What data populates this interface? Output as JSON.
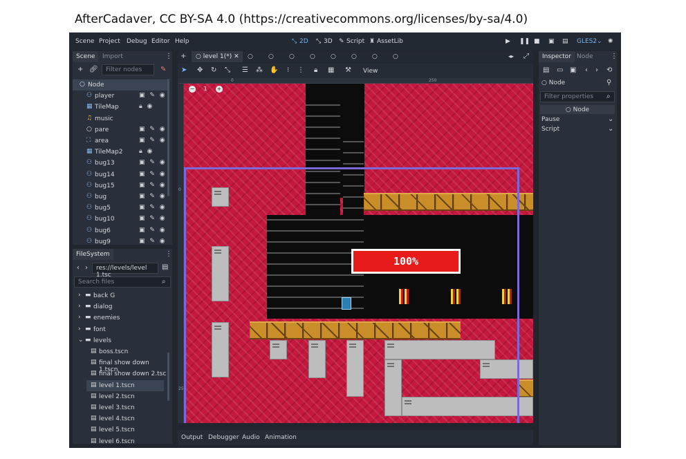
{
  "attribution": "AfterCadaver, CC BY-SA 4.0 (https://creativecommons.org/licenses/by-sa/4.0)",
  "menu": {
    "items": [
      "Scene",
      "Project",
      "Debug",
      "Editor",
      "Help"
    ],
    "modes": [
      "2D",
      "3D",
      "Script",
      "AssetLib"
    ],
    "renderer": "GLES2"
  },
  "scene_dock": {
    "tabs": [
      "Scene",
      "Import"
    ],
    "filter_placeholder": "Filter nodes",
    "nodes": [
      {
        "name": "Node",
        "icon": "circle-icon",
        "selected": true
      },
      {
        "name": "player",
        "icon": "character-icon"
      },
      {
        "name": "TileMap",
        "icon": "tilemap-icon"
      },
      {
        "name": "music",
        "icon": "audio-icon"
      },
      {
        "name": "pare",
        "icon": "circle-icon"
      },
      {
        "name": "area",
        "icon": "area-icon"
      },
      {
        "name": "TileMap2",
        "icon": "tilemap-icon"
      },
      {
        "name": "bug13",
        "icon": "character-icon"
      },
      {
        "name": "bug14",
        "icon": "character-icon"
      },
      {
        "name": "bug15",
        "icon": "character-icon"
      },
      {
        "name": "bug",
        "icon": "character-icon"
      },
      {
        "name": "bug5",
        "icon": "character-icon"
      },
      {
        "name": "bug10",
        "icon": "character-icon"
      },
      {
        "name": "bug6",
        "icon": "character-icon"
      },
      {
        "name": "bug9",
        "icon": "character-icon"
      }
    ]
  },
  "filesystem": {
    "tab": "FileSystem",
    "path": "res://levels/level 1.tsc",
    "search_placeholder": "Search files",
    "entries": [
      {
        "name": "back G",
        "type": "folder"
      },
      {
        "name": "dialog",
        "type": "folder"
      },
      {
        "name": "enemies",
        "type": "folder"
      },
      {
        "name": "font",
        "type": "folder"
      },
      {
        "name": "levels",
        "type": "folder"
      },
      {
        "name": "boss.tscn",
        "type": "scene"
      },
      {
        "name": "final show down 1.tscn",
        "type": "scene"
      },
      {
        "name": "final show down 2.tsc",
        "type": "scene"
      },
      {
        "name": "level 1.tscn",
        "type": "scene",
        "selected": true
      },
      {
        "name": "level 2.tscn",
        "type": "scene"
      },
      {
        "name": "level 3.tscn",
        "type": "scene"
      },
      {
        "name": "level 4.tscn",
        "type": "scene"
      },
      {
        "name": "level 5.tscn",
        "type": "scene"
      },
      {
        "name": "level 6.tscn",
        "type": "scene"
      }
    ]
  },
  "editor": {
    "active_tab": "level 1(*)",
    "toolbar_view": "View",
    "ruler": {
      "top_250": "250",
      "left_0": "0",
      "left_250": "250"
    },
    "zoom": "1",
    "hud_text": "100%"
  },
  "bottom": {
    "tabs": [
      "Output",
      "Debugger",
      "Audio",
      "Animation"
    ]
  },
  "inspector": {
    "tabs": [
      "Inspector",
      "Node"
    ],
    "node_name": "Node",
    "filter_placeholder": "Filter properties",
    "header": "Node",
    "sections": [
      "Pause",
      "Script"
    ]
  },
  "colors": {
    "accent": "#78b6f5",
    "camera": "#7b68d9",
    "hud_red": "#e81b1b"
  }
}
